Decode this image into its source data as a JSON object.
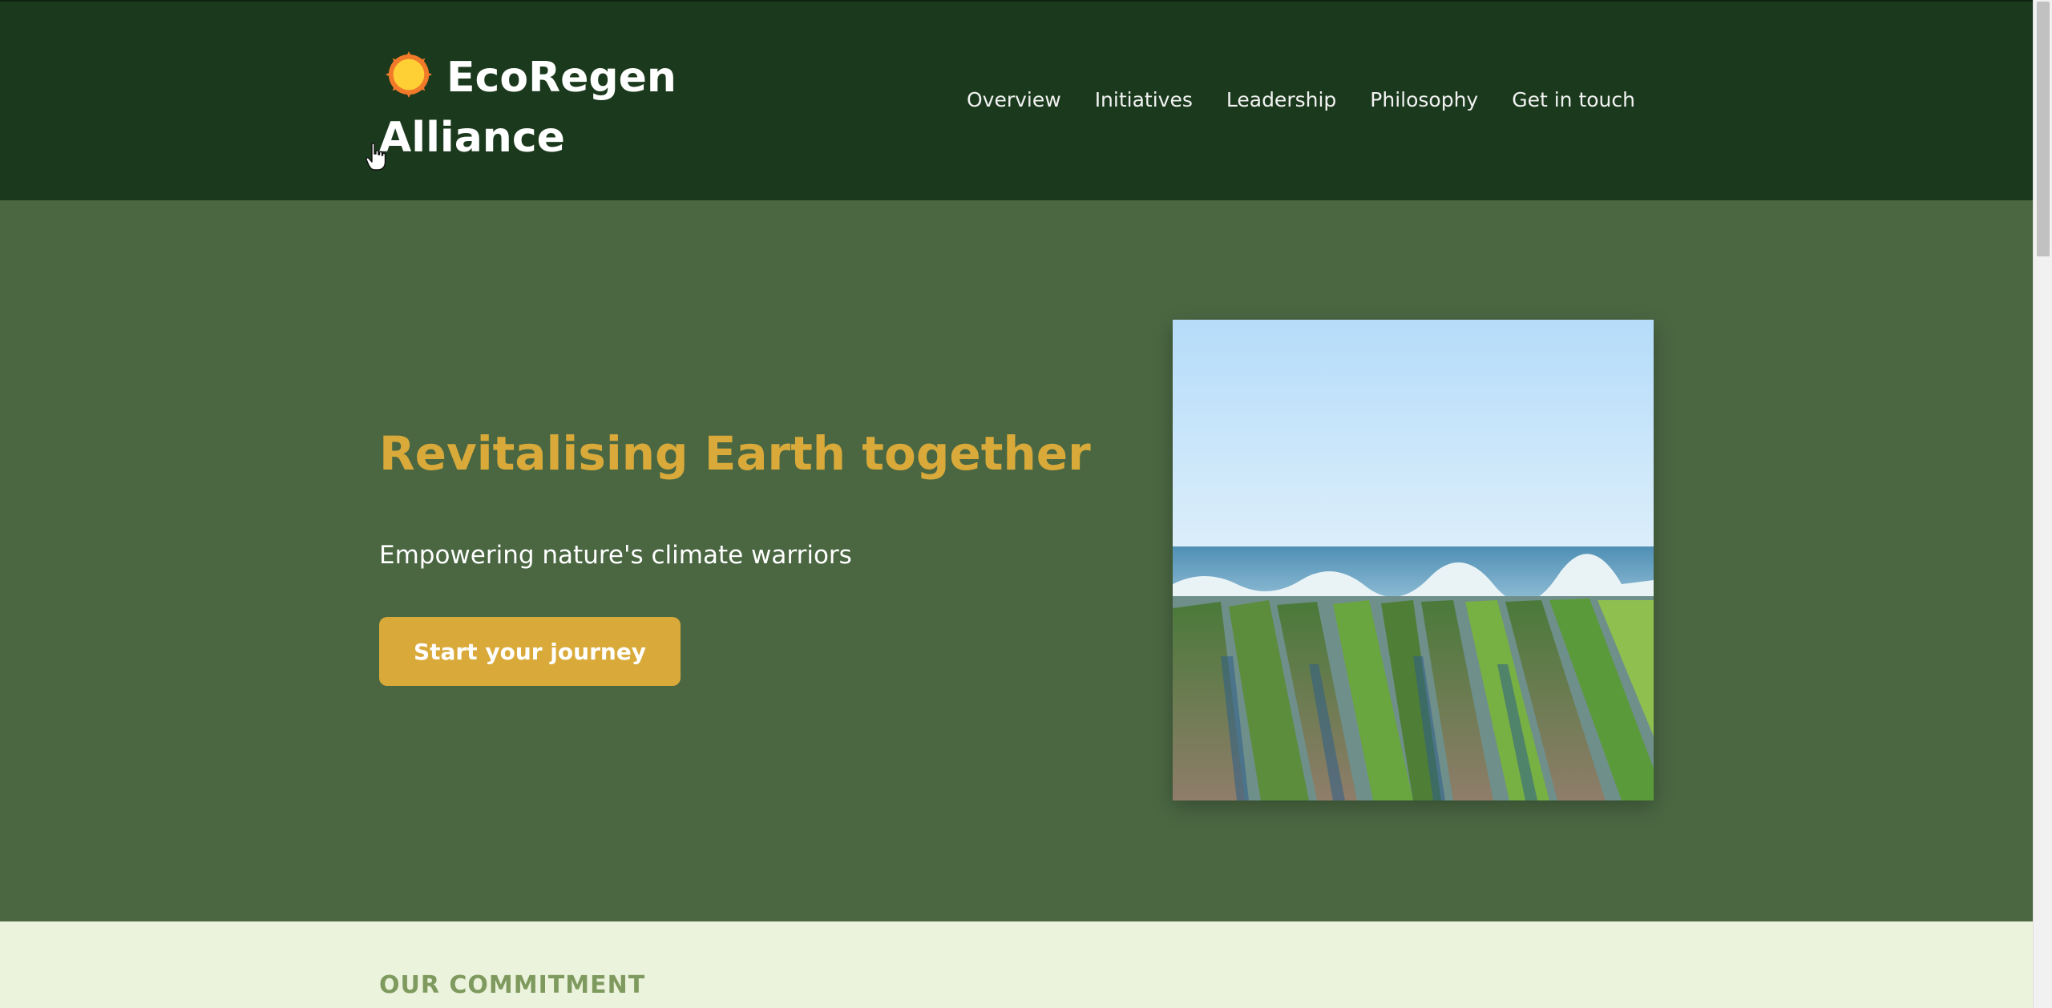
{
  "header": {
    "brand_name": "EcoRegen Alliance",
    "brand_icon": "sun-icon",
    "nav": [
      {
        "label": "Overview"
      },
      {
        "label": "Initiatives"
      },
      {
        "label": "Leadership"
      },
      {
        "label": "Philosophy"
      },
      {
        "label": "Get in touch"
      }
    ]
  },
  "hero": {
    "title": "Revitalising Earth together",
    "subtitle": "Empowering nature's climate warriors",
    "cta_label": "Start your journey"
  },
  "commitment": {
    "label": "OUR COMMITMENT"
  },
  "colors": {
    "header_bg": "#1b3a1d",
    "hero_bg": "#4a6742",
    "accent": "#d9aa3a",
    "section_bg": "#ecf3dc",
    "section_label": "#7f9a5e"
  }
}
